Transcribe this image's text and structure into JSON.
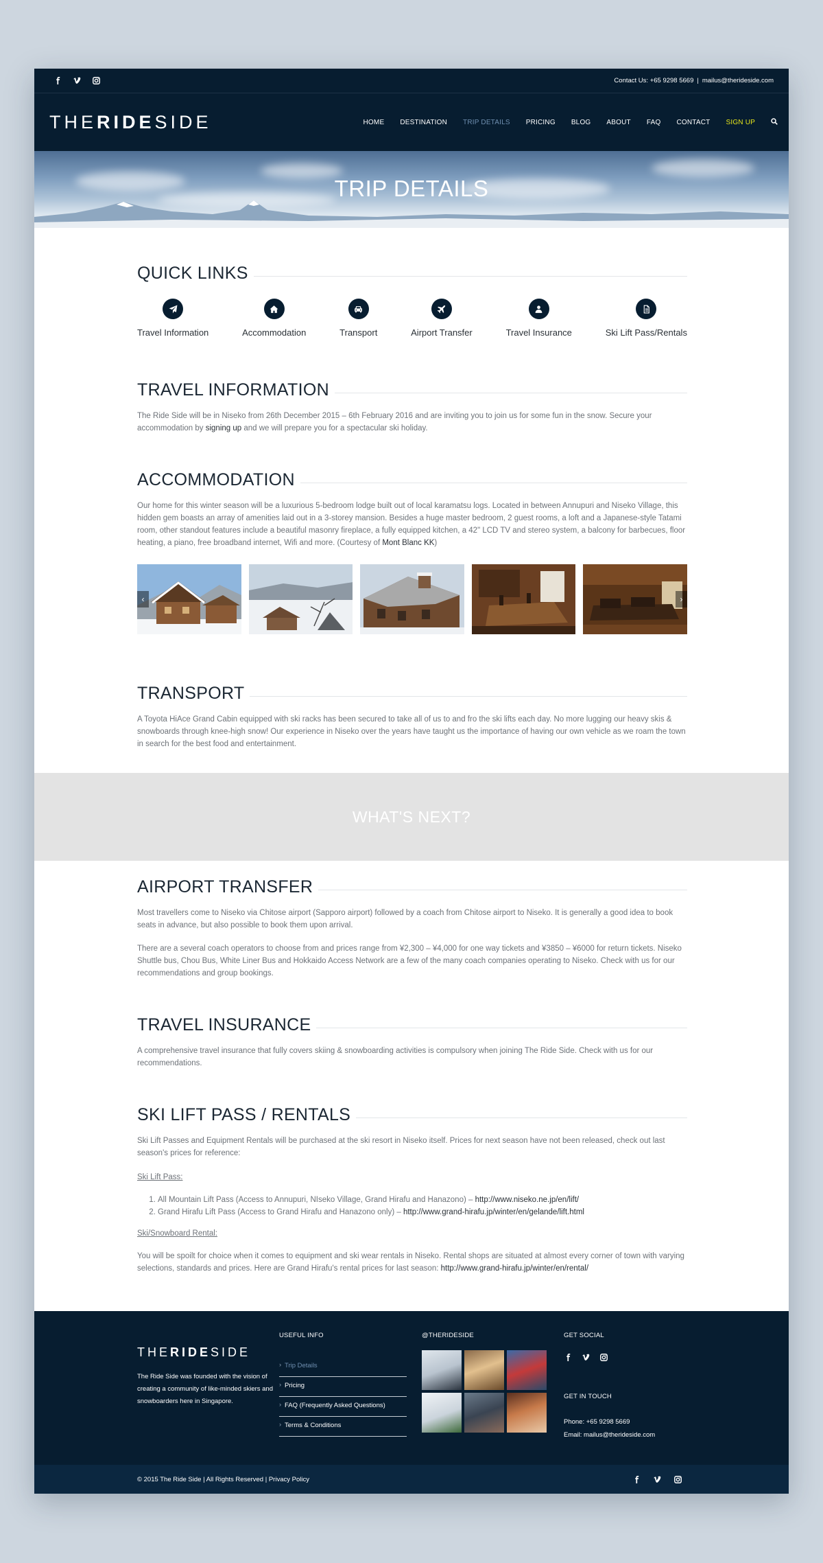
{
  "topbar": {
    "social_icons": [
      "facebook-icon",
      "vimeo-icon",
      "instagram-icon"
    ],
    "contact_text": "Contact Us: +65 9298 5669",
    "separator": "|",
    "email": "mailus@therideside.com"
  },
  "header": {
    "logo_pre": "THE",
    "logo_bold": "RIDE",
    "logo_post": "SIDE",
    "nav": [
      {
        "label": "HOME"
      },
      {
        "label": "DESTINATION"
      },
      {
        "label": "TRIP DETAILS",
        "active": true
      },
      {
        "label": "PRICING"
      },
      {
        "label": "BLOG"
      },
      {
        "label": "ABOUT"
      },
      {
        "label": "FAQ"
      },
      {
        "label": "CONTACT"
      },
      {
        "label": "SIGN UP"
      }
    ]
  },
  "hero": {
    "title": "TRIP DETAILS"
  },
  "quick_links": {
    "title": "QUICK LINKS",
    "items": [
      {
        "label": "Travel Information",
        "icon": "paper-plane-icon"
      },
      {
        "label": "Accommodation",
        "icon": "home-icon"
      },
      {
        "label": "Transport",
        "icon": "car-icon"
      },
      {
        "label": "Airport Transfer",
        "icon": "plane-icon"
      },
      {
        "label": "Travel Insurance",
        "icon": "insurance-icon"
      },
      {
        "label": "Ski Lift Pass/Rentals",
        "icon": "document-icon"
      }
    ]
  },
  "travel_information": {
    "title": "TRAVEL INFORMATION",
    "text_pre": "The Ride Side will be in Niseko from 26th December 2015 – 6th February 2016 and are inviting you to join us for some fun in the snow. Secure your accommodation by ",
    "link": "signing up",
    "text_post": " and we will prepare you for a spectacular ski holiday."
  },
  "accommodation": {
    "title": "ACCOMMODATION",
    "text_pre": "Our home for this winter season will be a luxurious 5-bedroom lodge built out of local karamatsu logs. Located in between Annupuri and Niseko Village, this hidden gem boasts an array of amenities laid out in a 3-storey mansion. Besides a huge master bedroom, 2 guest rooms, a loft and a Japanese-style Tatami room, other standout features include a beautiful masonry fireplace, a fully equipped kitchen, a 42\" LCD TV and stereo system, a balcony for barbecues, floor heating, a piano, free broadband internet, Wifi and more. (Courtesy of ",
    "link": "Mont Blanc KK",
    "text_post": ")",
    "prev_arrow": "‹",
    "next_arrow": "›"
  },
  "transport": {
    "title": "TRANSPORT",
    "text": "A Toyota HiAce Grand Cabin equipped with ski racks has been secured to take all of us to and fro the ski lifts each day. No more lugging our heavy skis & snowboards through knee-high snow! Our experience in Niseko over the years have taught us the importance of having our own vehicle as we roam the town in search for the best food and entertainment."
  },
  "whats_next": {
    "label": "WHAT'S NEXT?"
  },
  "airport_transfer": {
    "title": "AIRPORT TRANSFER",
    "text1": "Most travellers come to Niseko via Chitose airport (Sapporo airport) followed by a coach from Chitose airport to Niseko. It is generally a good idea to book seats in advance, but also possible to book them upon arrival.",
    "text2": "There are a several coach operators to choose from and prices range from ¥2,300 – ¥4,000 for one way tickets and ¥3850 – ¥6000 for return tickets. Niseko Shuttle bus, Chou Bus, White Liner Bus and Hokkaido Access Network are a few of the many coach companies operating to Niseko. Check with us for our recommendations and group bookings."
  },
  "travel_insurance": {
    "title": "TRAVEL INSURANCE",
    "text": "A comprehensive travel insurance that fully covers skiing & snowboarding activities is compulsory when joining The Ride Side. Check with us for our recommendations."
  },
  "ski_lift": {
    "title": "SKI LIFT PASS / RENTALS",
    "text": "Ski Lift Passes and Equipment Rentals will be purchased at the ski resort in Niseko itself. Prices for next season have not been released, check out last season's prices for reference:",
    "lift_pass_heading": "Ski Lift Pass:",
    "passes": [
      {
        "text": "All Mountain Lift Pass (Access to Annupuri, NIseko Village, Grand Hirafu and Hanazono) – ",
        "link": "http://www.niseko.ne.jp/en/lift/"
      },
      {
        "text": "Grand Hirafu Lift Pass (Access to Grand Hirafu and Hanazono only) – ",
        "link": "http://www.grand-hirafu.jp/winter/en/gelande/lift.html"
      }
    ],
    "rental_heading": "Ski/Snowboard Rental:",
    "rental_text": "You will be spoilt for choice when it comes to equipment and ski wear rentals in Niseko. Rental shops are situated at almost every corner of town with varying selections, standards  and prices. Here are Grand Hirafu's rental prices for last season: ",
    "rental_link": "http://www.grand-hirafu.jp/winter/en/rental/"
  },
  "footer": {
    "logo_pre": "THE",
    "logo_bold": "RIDE",
    "logo_post": "SIDE",
    "description": "The Ride Side was founded with the vision of creating a community of like-minded skiers and snowboarders here in Singapore.",
    "useful_info_title": "USEFUL INFO",
    "useful_links": [
      {
        "label": "Trip Details",
        "active": true
      },
      {
        "label": "Pricing"
      },
      {
        "label": "FAQ (Frequently Asked Questions)"
      },
      {
        "label": "Terms & Conditions"
      }
    ],
    "instagram_title": "@THERIDESIDE",
    "get_social_title": "GET SOCIAL",
    "get_in_touch_title": "GET IN TOUCH",
    "phone": "Phone: +65 9298 5669",
    "email": "Email: mailus@therideside.com"
  },
  "bottombar": {
    "copyright": "© 2015 The Ride Side | All Rights Reserved | ",
    "privacy": "Privacy Policy"
  }
}
